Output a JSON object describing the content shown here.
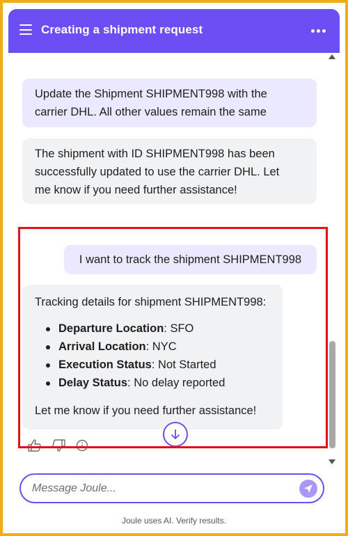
{
  "header": {
    "title": "Creating a shipment request"
  },
  "messages": {
    "m1": {
      "line1": "Update the Shipment SHIPMENT998 with the",
      "line2": "carrier DHL. All other values remain the same"
    },
    "m2": {
      "line1": "The shipment with ID SHIPMENT998 has been",
      "line2": "successfully updated to use the carrier DHL. Let",
      "line3": "me know if you need further assistance!"
    },
    "m3": {
      "text": "I want to track the shipment SHIPMENT998"
    },
    "m4": {
      "intro": "Tracking details for shipment SHIPMENT998:",
      "items": [
        {
          "label": "Departure Location",
          "value": ": SFO"
        },
        {
          "label": "Arrival Location",
          "value": ": NYC"
        },
        {
          "label": "Execution Status",
          "value": ": Not Started"
        },
        {
          "label": "Delay Status",
          "value": ": No delay reported"
        }
      ],
      "outro": "Let me know if you need further assistance!"
    }
  },
  "composer": {
    "placeholder": "Message Joule..."
  },
  "footer": {
    "disclaimer": "Joule uses AI. Verify results."
  },
  "colors": {
    "accent": "#6b4ff5",
    "highlight_box": "#e0111b",
    "outer_border": "#f2ad13"
  },
  "icons": [
    "menu-icon",
    "more-icon",
    "thumbs-up-icon",
    "thumbs-down-icon",
    "info-icon",
    "arrow-down-icon",
    "send-icon"
  ]
}
